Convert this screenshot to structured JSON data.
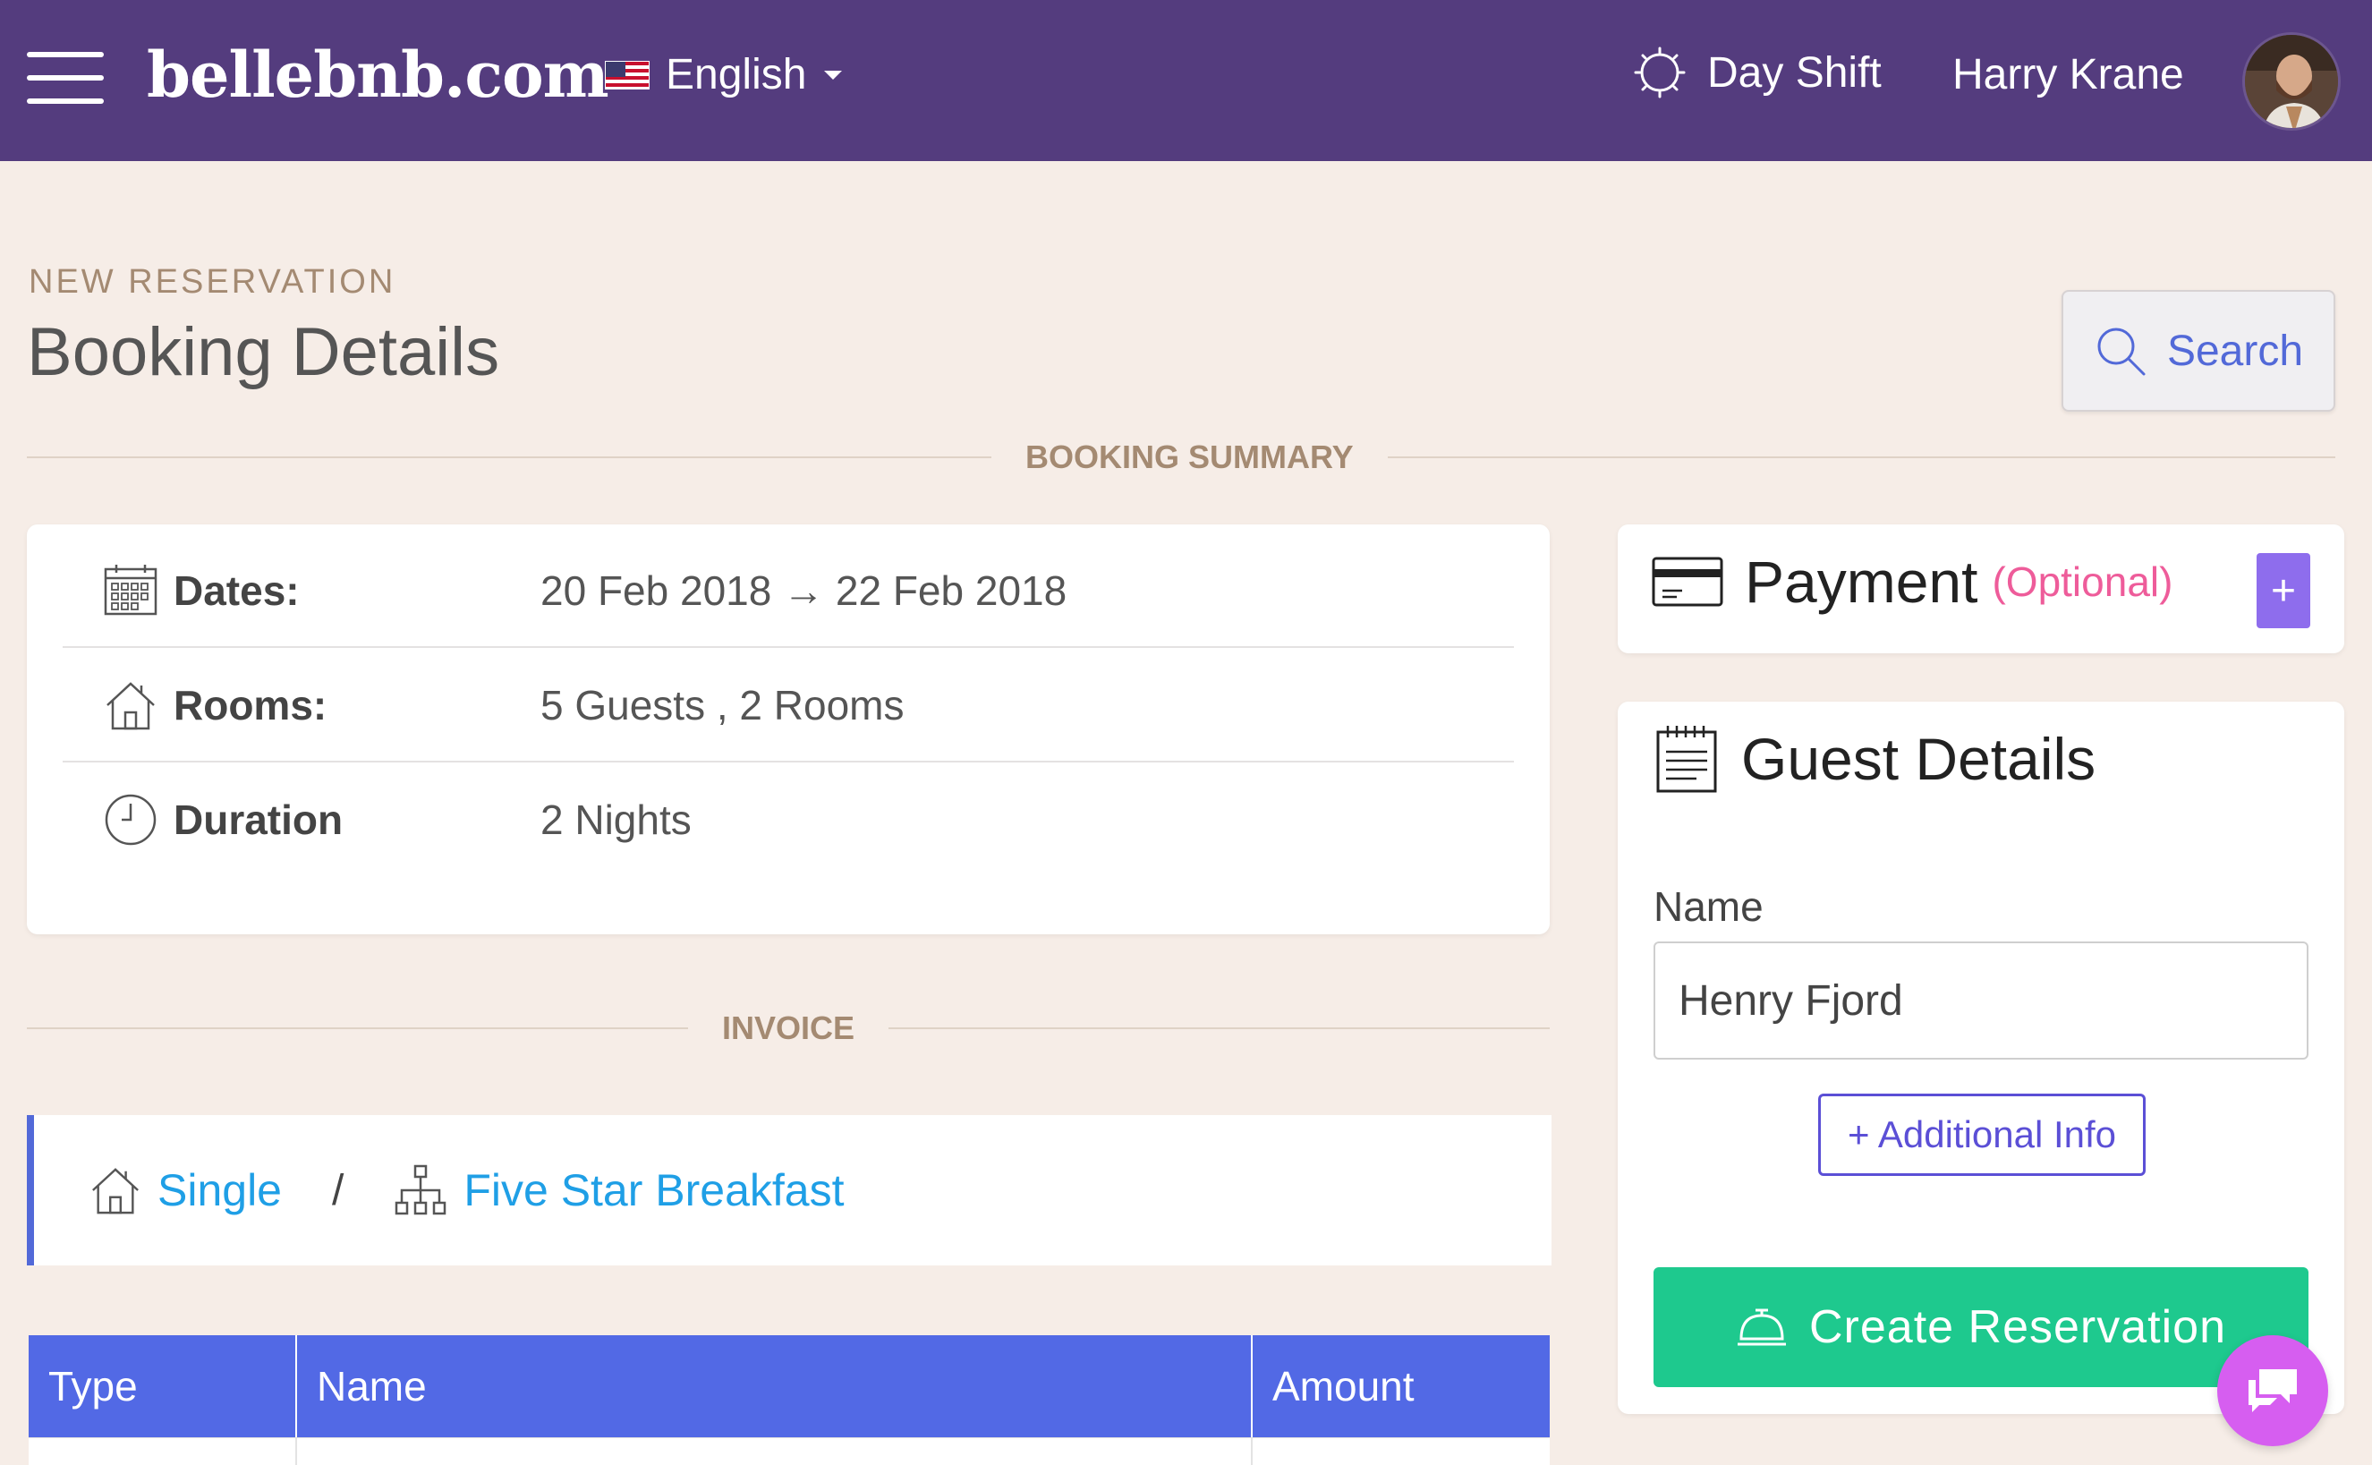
{
  "header": {
    "brand": "bellebnb.com",
    "language": "English",
    "shift": "Day Shift",
    "user_name": "Harry Krane",
    "icons": {
      "menu": "hamburger-icon",
      "flag": "us-flag-icon",
      "shift": "sun-icon"
    }
  },
  "page": {
    "eyebrow": "NEW RESERVATION",
    "title": "Booking Details",
    "search_label": "Search"
  },
  "booking_summary": {
    "heading": "BOOKING SUMMARY",
    "rows": [
      {
        "icon": "calendar-icon",
        "label": "Dates:",
        "value": "20 Feb 2018 → 22 Feb 2018"
      },
      {
        "icon": "house-icon",
        "label": "Rooms:",
        "value": "5 Guests , 2 Rooms"
      },
      {
        "icon": "clock-icon",
        "label": "Duration",
        "value": "2 Nights"
      }
    ]
  },
  "payment": {
    "title": "Payment",
    "optional": "(Optional)",
    "add_label": "+"
  },
  "guest_details": {
    "title": "Guest Details",
    "name_label": "Name",
    "name_value": "Henry Fjord",
    "additional_info": "+ Additional Info",
    "create_label": "Create Reservation"
  },
  "invoice": {
    "heading": "INVOICE",
    "room_type": "Single",
    "separator": "/",
    "package": "Five Star Breakfast",
    "columns": [
      "Type",
      "Name",
      "Amount"
    ]
  },
  "colors": {
    "header_bg": "#543c7e",
    "page_bg": "#f6ede7",
    "accent_blue": "#5269e5",
    "link_blue": "#1f9fe6",
    "create_green": "#1ec98e",
    "optional_pink": "#ee5c9a",
    "chat_purple": "#d65ef0"
  }
}
